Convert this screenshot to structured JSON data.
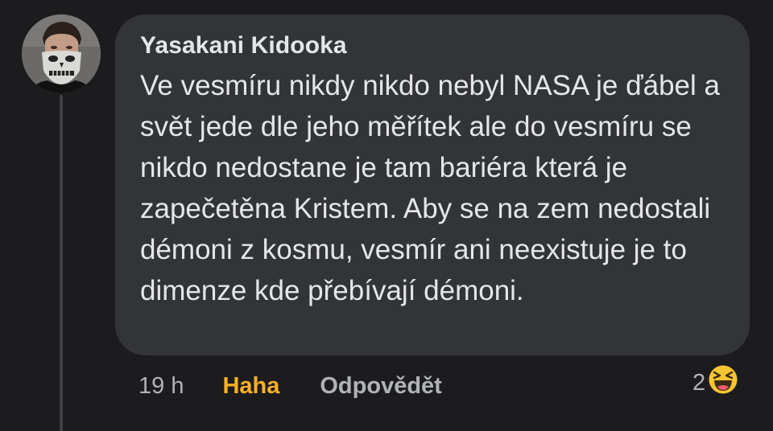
{
  "comment": {
    "author": "Yasakani Kidooka",
    "text": "Ve vesmíru nikdy nikdo nebyl NASA je ďábel a svět jede dle jeho měřítek ale do vesmíru se nikdo nedostane je tam bariéra která je zapečetěna Kristem. Aby se na zem nedostali démoni z kosmu, vesmír ani neexistuje je to dimenze kde přebívají démoni.",
    "avatar_icon": "profile-photo-skull-mask"
  },
  "actions": {
    "time": "19 h",
    "reaction_label": "Haha",
    "reaction_color": "#f7b125",
    "reply_label": "Odpovědět"
  },
  "reactions": {
    "count": "2",
    "icon": "haha-emoji-icon"
  },
  "colors": {
    "background": "#1c1c1e",
    "bubble": "#333436",
    "text": "#e4e6eb",
    "muted": "#b0b3b8"
  }
}
